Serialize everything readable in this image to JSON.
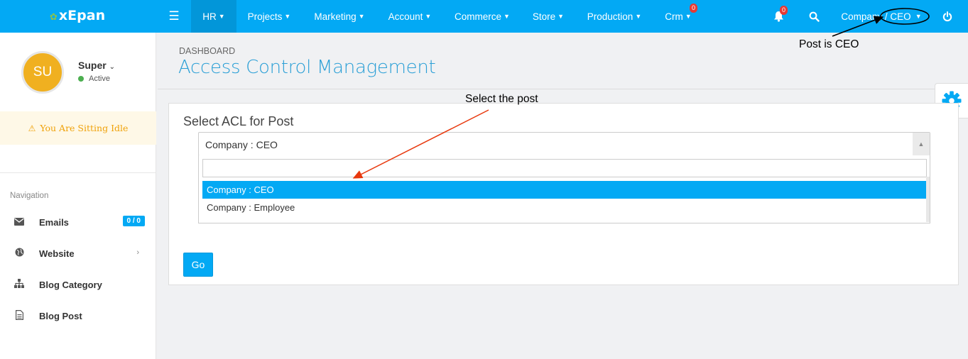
{
  "brand": {
    "name": "xEpan",
    "leaf_icon": "leaf-icon"
  },
  "topnav": {
    "menu_icon": "hamburger-icon",
    "items": [
      {
        "label": "HR",
        "active": true
      },
      {
        "label": "Projects"
      },
      {
        "label": "Marketing"
      },
      {
        "label": "Account"
      },
      {
        "label": "Commerce"
      },
      {
        "label": "Store"
      },
      {
        "label": "Production"
      },
      {
        "label": "Crm",
        "badge": "0"
      }
    ],
    "notification_badge": "0",
    "user_menu_label": "Company / CEO",
    "icons": [
      "bell-icon",
      "search-icon",
      "power-icon"
    ]
  },
  "sidebar": {
    "avatar_initials": "SU",
    "user_name": "Super",
    "status": "Active",
    "idle_message": "You Are Sitting Idle",
    "nav_heading": "Navigation",
    "items": [
      {
        "label": "Emails",
        "icon": "envelope-icon",
        "count": "0 / 0"
      },
      {
        "label": "Website",
        "icon": "globe-icon",
        "chevron": true
      },
      {
        "label": "Blog Category",
        "icon": "sitemap-icon"
      },
      {
        "label": "Blog Post",
        "icon": "document-icon"
      }
    ]
  },
  "page": {
    "breadcrumb": "DASHBOARD",
    "title": "Access Control Management"
  },
  "acl_form": {
    "title": "Select ACL for Post",
    "selected_value": "Company : CEO",
    "search_value": "",
    "options": [
      "Company : CEO",
      "Company : Employee"
    ],
    "highlighted_option": "Company : CEO",
    "go_label": "Go"
  },
  "annotations": {
    "post_note": "Post is CEO",
    "select_note": "Select the post",
    "arrow_color": "#e8380d"
  },
  "colors": {
    "primary": "#03a9f4",
    "idle_text": "#f0a20a",
    "badge": "#e53935"
  }
}
